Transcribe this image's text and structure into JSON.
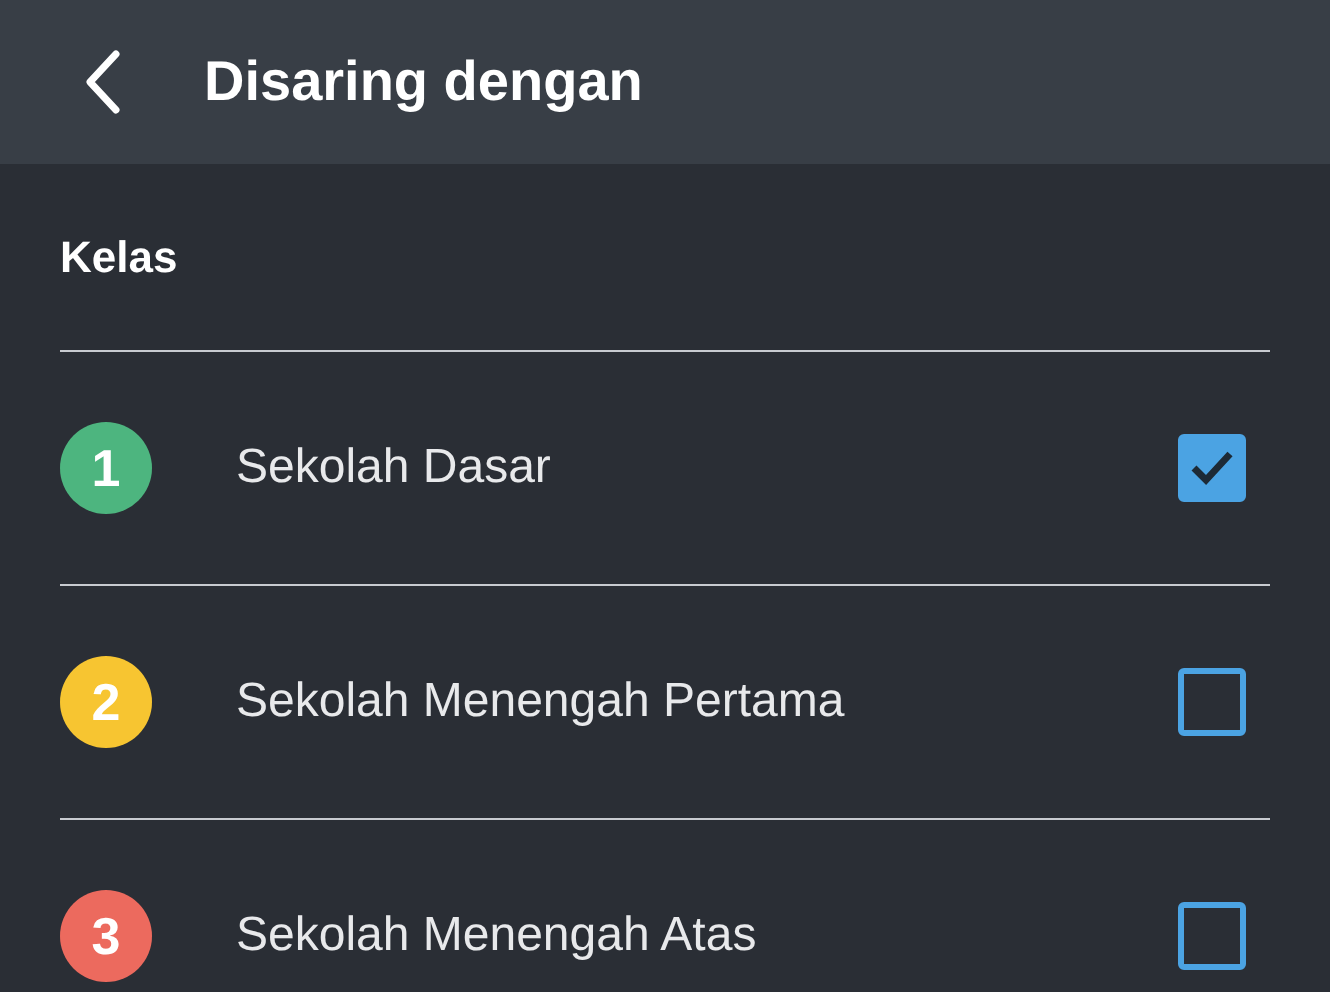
{
  "header": {
    "title": "Disaring dengan"
  },
  "section": {
    "title": "Kelas"
  },
  "items": [
    {
      "number": "1",
      "label": "Sekolah Dasar",
      "color": "#4db57f",
      "checked": true
    },
    {
      "number": "2",
      "label": "Sekolah Menengah Pertama",
      "color": "#f7c531",
      "checked": false
    },
    {
      "number": "3",
      "label": "Sekolah Menengah Atas",
      "color": "#ec6a5e",
      "checked": false
    }
  ]
}
